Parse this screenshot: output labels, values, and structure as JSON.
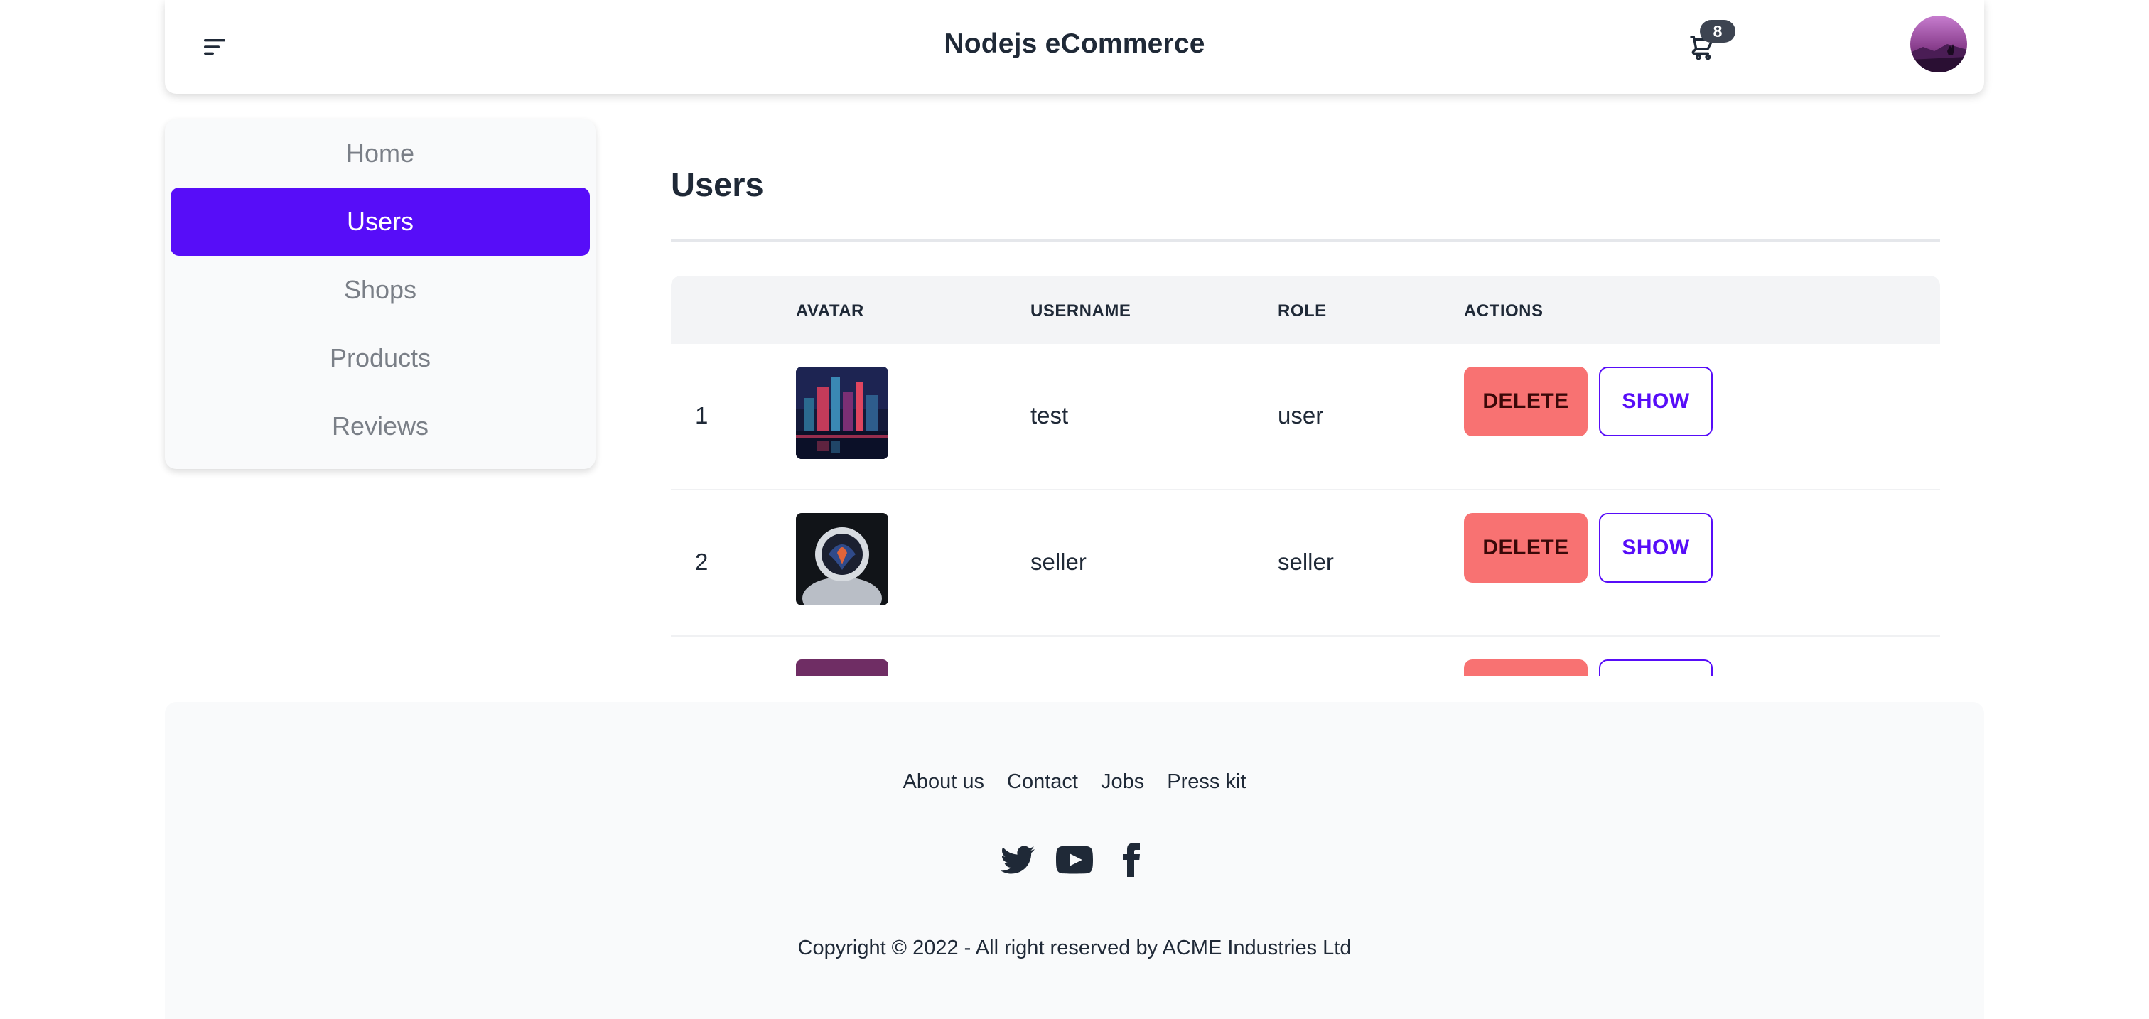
{
  "navbar": {
    "title": "Nodejs eCommerce",
    "cart_count": "8",
    "menu_icon": "hamburger-menu-icon",
    "cart_icon": "shopping-cart-icon"
  },
  "sidebar": {
    "items": [
      {
        "label": "Home",
        "active": false
      },
      {
        "label": "Users",
        "active": true
      },
      {
        "label": "Shops",
        "active": false
      },
      {
        "label": "Products",
        "active": false
      },
      {
        "label": "Reviews",
        "active": false
      }
    ]
  },
  "main": {
    "title": "Users",
    "table": {
      "headers": [
        "",
        "AVATAR",
        "USERNAME",
        "ROLE",
        "ACTIONS"
      ],
      "rows": [
        {
          "index": "1",
          "username": "test",
          "role": "user"
        },
        {
          "index": "2",
          "username": "seller",
          "role": "seller"
        },
        {
          "index": "",
          "username": "",
          "role": ""
        }
      ],
      "delete_label": "DELETE",
      "show_label": "SHOW"
    }
  },
  "footer": {
    "links": [
      "About us",
      "Contact",
      "Jobs",
      "Press kit"
    ],
    "social": [
      "twitter-icon",
      "youtube-icon",
      "facebook-icon"
    ],
    "copyright": "Copyright © 2022 - All right reserved by ACME Industries Ltd"
  },
  "colors": {
    "primary": "#570df8",
    "error": "#f87272",
    "neutral": "#3d4451",
    "base_200": "#f9fafb"
  }
}
